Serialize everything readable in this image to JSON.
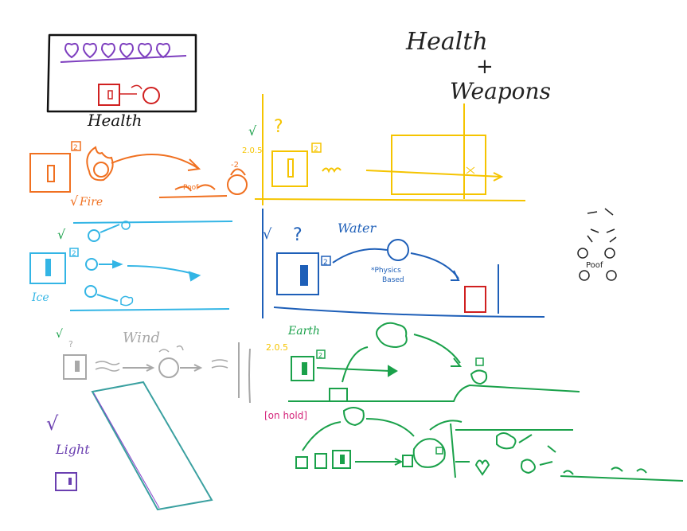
{
  "title_line1": "Health",
  "title_plus": "+",
  "title_line2": "Weapons",
  "health_label": "Health",
  "hearts_count": 6,
  "sections": {
    "fire": {
      "label": "Fire",
      "check": "√",
      "badge": "2",
      "poof": "Poof",
      "damage": "-2",
      "color": "#f07020"
    },
    "yellow": {
      "check": "√",
      "question": "?",
      "ver": "2.0.5",
      "badge": "2",
      "color": "#f5c400"
    },
    "ice": {
      "label": "Ice",
      "check": "√",
      "badge": "2",
      "color": "#33b5e5"
    },
    "water": {
      "label": "Water",
      "check": "√",
      "question": "?",
      "badge": "2",
      "note_line1": "*Physics",
      "note_line2": "Based",
      "color": "#1e5fb8"
    },
    "wind": {
      "label": "Wind",
      "check": "√",
      "question": "?",
      "color": "#a8a8a8"
    },
    "earth": {
      "label": "Earth",
      "ver": "2.0.5",
      "badge": "2",
      "color": "#1aa14a"
    },
    "onhold": {
      "label": "[on hold]",
      "color": "#d4237a"
    },
    "light": {
      "label": "Light",
      "check": "√",
      "color": "#6a3fb0"
    },
    "poof_side": {
      "label": "Poof",
      "color": "#222222"
    }
  }
}
